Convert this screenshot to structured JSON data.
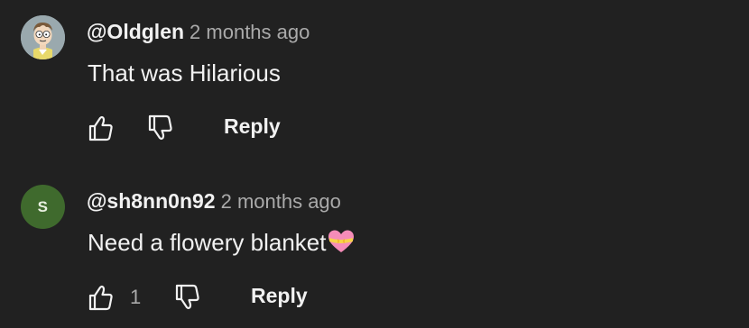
{
  "comments": [
    {
      "author": "@Oldglen",
      "time": "2 months ago",
      "text": "That was Hilarious",
      "avatar": "cartoon-character-avatar",
      "likes": "",
      "reply_label": "Reply"
    },
    {
      "author": "@sh8nn0n92",
      "time": "2 months ago",
      "text": "Need a flowery blanket",
      "avatar_letter": "S",
      "avatar_color": "#3f6a2d",
      "emoji": "heart-with-ribbon",
      "likes": "1",
      "reply_label": "Reply"
    }
  ],
  "colors": {
    "background": "#212121",
    "primary_text": "#f1f1f1",
    "secondary_text": "#aaaaaa"
  },
  "icons": [
    "thumbs-up-icon",
    "thumbs-down-icon"
  ]
}
